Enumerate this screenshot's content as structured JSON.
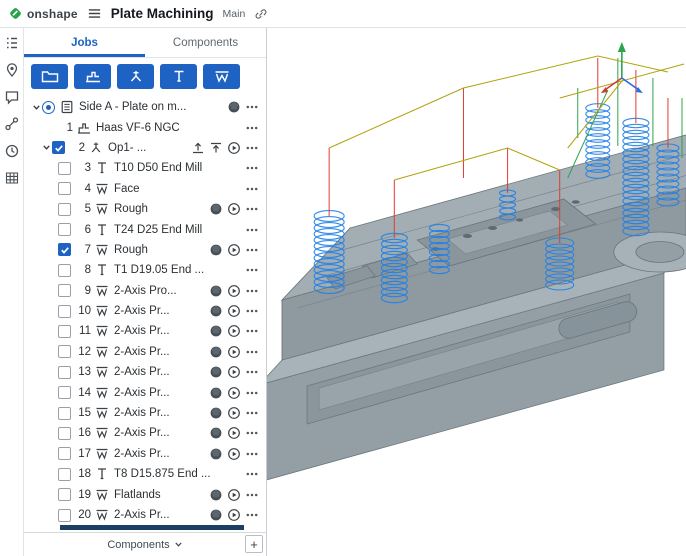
{
  "colors": {
    "accent": "#1e63c4",
    "logo_green": "#27a34a",
    "toolpath_blue": "#1f7fe8",
    "rapid_red": "#e03c31",
    "lead_green": "#2da44e",
    "link_yellow": "#b0a20c",
    "part_gray": "#a2aeb4",
    "selected_row_bar": "#1c3f66"
  },
  "header": {
    "app_name": "onshape",
    "title": "Plate Machining",
    "branch": "Main"
  },
  "rail": {
    "icons": [
      "tree-icon",
      "pin-icon",
      "comment-icon",
      "nodes-icon",
      "history-icon",
      "table-icon"
    ]
  },
  "panel": {
    "tabs": [
      {
        "label": "Jobs",
        "active": true
      },
      {
        "label": "Components",
        "active": false
      }
    ],
    "toolbar": {
      "buttons": [
        {
          "name": "new-folder-button",
          "icon": "folder-icon"
        },
        {
          "name": "add-machine-button",
          "icon": "machine-icon"
        },
        {
          "name": "add-operation-button",
          "icon": "operation-icon"
        },
        {
          "name": "add-tool-button",
          "icon": "tool-icon"
        },
        {
          "name": "add-toolpath-button",
          "icon": "toolpath-icon"
        }
      ]
    },
    "rows": [
      {
        "indent": 0,
        "chevron": true,
        "control": "radio-selected",
        "num": "",
        "kind": "job",
        "label": "Side A - Plate on m...",
        "trailing": [
          "sim",
          "dots"
        ]
      },
      {
        "indent": 2,
        "chevron": false,
        "control": "",
        "num": "1",
        "kind": "machine",
        "label": "Haas VF-6 NGC",
        "trailing": [
          "dots"
        ]
      },
      {
        "indent": 1,
        "chevron": true,
        "control": "checkbox-checked",
        "num": "2",
        "kind": "op",
        "label": "Op1- ...",
        "trailing": [
          "publish",
          "raise",
          "play",
          "dots"
        ]
      },
      {
        "indent": 2,
        "chevron": false,
        "control": "checkbox",
        "num": "3",
        "kind": "tool",
        "label": "T10 D50 End Mill",
        "trailing": [
          "dots"
        ]
      },
      {
        "indent": 2,
        "chevron": false,
        "control": "checkbox",
        "num": "4",
        "kind": "toolpath",
        "label": "Face",
        "trailing": [
          "dots"
        ]
      },
      {
        "indent": 2,
        "chevron": false,
        "control": "checkbox",
        "num": "5",
        "kind": "toolpath",
        "label": "Rough",
        "trailing": [
          "sim",
          "play",
          "dots"
        ]
      },
      {
        "indent": 2,
        "chevron": false,
        "control": "checkbox",
        "num": "6",
        "kind": "tool",
        "label": "T24 D25 End Mill",
        "trailing": [
          "dots"
        ]
      },
      {
        "indent": 2,
        "chevron": false,
        "control": "checkbox-checked",
        "num": "7",
        "kind": "toolpath",
        "label": "Rough",
        "trailing": [
          "sim",
          "play",
          "dots"
        ]
      },
      {
        "indent": 2,
        "chevron": false,
        "control": "checkbox",
        "num": "8",
        "kind": "tool",
        "label": "T1 D19.05 End ...",
        "trailing": [
          "dots"
        ]
      },
      {
        "indent": 2,
        "chevron": false,
        "control": "checkbox",
        "num": "9",
        "kind": "toolpath",
        "label": "2-Axis Pro...",
        "trailing": [
          "sim",
          "play",
          "dots"
        ]
      },
      {
        "indent": 2,
        "chevron": false,
        "control": "checkbox",
        "num": "10",
        "kind": "toolpath",
        "label": "2-Axis Pr...",
        "trailing": [
          "sim",
          "play",
          "dots"
        ]
      },
      {
        "indent": 2,
        "chevron": false,
        "control": "checkbox",
        "num": "11",
        "kind": "toolpath",
        "label": "2-Axis Pr...",
        "trailing": [
          "sim",
          "play",
          "dots"
        ]
      },
      {
        "indent": 2,
        "chevron": false,
        "control": "checkbox",
        "num": "12",
        "kind": "toolpath",
        "label": "2-Axis Pr...",
        "trailing": [
          "sim",
          "play",
          "dots"
        ]
      },
      {
        "indent": 2,
        "chevron": false,
        "control": "checkbox",
        "num": "13",
        "kind": "toolpath",
        "label": "2-Axis Pr...",
        "trailing": [
          "sim",
          "play",
          "dots"
        ]
      },
      {
        "indent": 2,
        "chevron": false,
        "control": "checkbox",
        "num": "14",
        "kind": "toolpath",
        "label": "2-Axis Pr...",
        "trailing": [
          "sim",
          "play",
          "dots"
        ]
      },
      {
        "indent": 2,
        "chevron": false,
        "control": "checkbox",
        "num": "15",
        "kind": "toolpath",
        "label": "2-Axis Pr...",
        "trailing": [
          "sim",
          "play",
          "dots"
        ]
      },
      {
        "indent": 2,
        "chevron": false,
        "control": "checkbox",
        "num": "16",
        "kind": "toolpath",
        "label": "2-Axis Pr...",
        "trailing": [
          "sim",
          "play",
          "dots"
        ]
      },
      {
        "indent": 2,
        "chevron": false,
        "control": "checkbox",
        "num": "17",
        "kind": "toolpath",
        "label": "2-Axis Pr...",
        "trailing": [
          "sim",
          "play",
          "dots"
        ]
      },
      {
        "indent": 2,
        "chevron": false,
        "control": "checkbox",
        "num": "18",
        "kind": "tool",
        "label": "T8 D15.875 End ...",
        "trailing": [
          "dots"
        ]
      },
      {
        "indent": 2,
        "chevron": false,
        "control": "checkbox",
        "num": "19",
        "kind": "toolpath",
        "label": "Flatlands",
        "trailing": [
          "sim",
          "play",
          "dots"
        ]
      },
      {
        "indent": 2,
        "chevron": false,
        "control": "checkbox",
        "num": "20",
        "kind": "toolpath",
        "label": "2-Axis Pr...",
        "trailing": [
          "sim",
          "play",
          "dots"
        ]
      }
    ],
    "footer": {
      "label": "Components",
      "add_button": "+"
    }
  },
  "viewport": {
    "triad_axes": [
      "x-red",
      "y-green",
      "z-blue"
    ]
  }
}
